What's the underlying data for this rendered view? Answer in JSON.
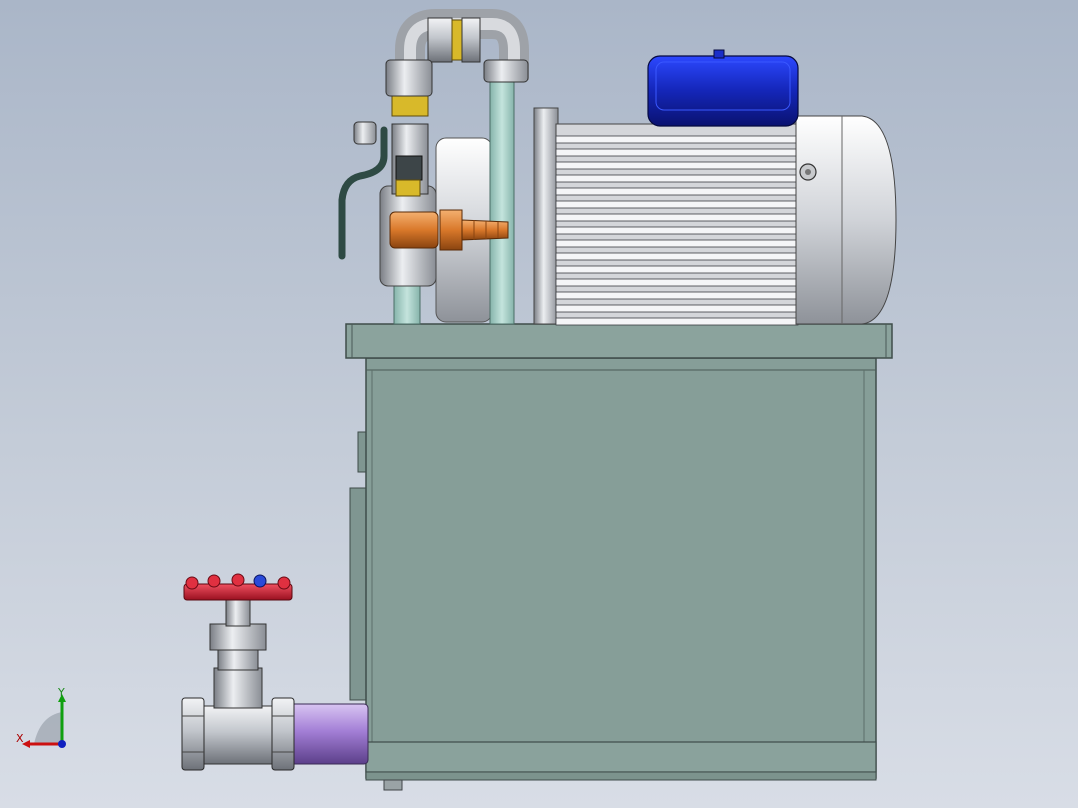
{
  "viewport": {
    "background_top": "#aab6c8",
    "background_bottom": "#d8dde6"
  },
  "model": {
    "description_parts": [
      "hydraulic-tank",
      "electric-motor",
      "terminal-box",
      "ball-valve",
      "hose-barb",
      "globe-valve",
      "return-pipe"
    ],
    "colors": {
      "tank": "#869e98",
      "tank_edge": "#4a5a56",
      "motor_body": "#d4d6da",
      "terminal_box": "#1a2ec8",
      "valve_handwheel": "#cc2030",
      "hose_barb": "#d9782a",
      "purple_pipe": "#a37fd6",
      "pipe_steel": "#b8bcc2",
      "green_tube": "#9ec9c0",
      "brass": "#d8b92a"
    }
  },
  "triad": {
    "x_label": "X",
    "y_label": "Y",
    "x_color": "#cc1010",
    "y_color": "#10a010",
    "z_color": "#1020c0"
  }
}
